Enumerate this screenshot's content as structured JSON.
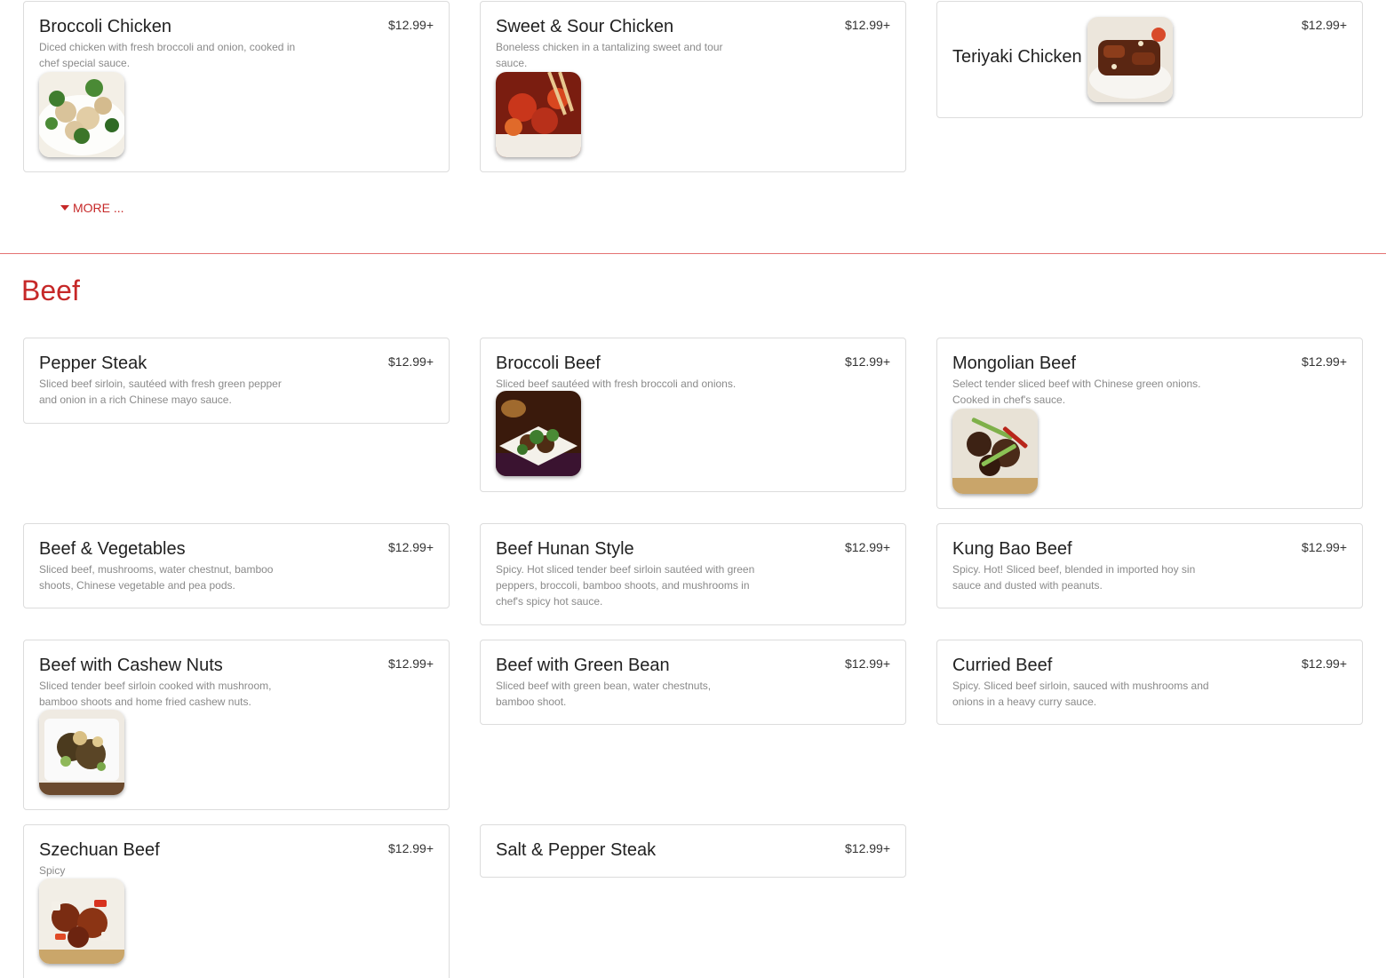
{
  "more_label": "MORE ...",
  "section_title": "Beef",
  "items": {
    "broccoli_chicken": {
      "name": "Broccoli Chicken",
      "price": "$12.99+",
      "desc": "Diced chicken with fresh broccoli and onion, cooked in chef special sauce."
    },
    "sweet_sour_chicken": {
      "name": "Sweet & Sour Chicken",
      "price": "$12.99+",
      "desc": "Boneless chicken in a tantalizing sweet and tour sauce."
    },
    "teriyaki_chicken": {
      "name": "Teriyaki Chicken",
      "price": "$12.99+"
    },
    "pepper_steak": {
      "name": "Pepper Steak",
      "price": "$12.99+",
      "desc": "Sliced beef sirloin, sautéed with fresh green pepper and onion in a rich Chinese mayo sauce."
    },
    "broccoli_beef": {
      "name": "Broccoli Beef",
      "price": "$12.99+",
      "desc": "Sliced beef sautéed with fresh broccoli and onions."
    },
    "mongolian_beef": {
      "name": "Mongolian Beef",
      "price": "$12.99+",
      "desc": "Select tender sliced beef with Chinese green onions. Cooked in chef's sauce."
    },
    "beef_vegetables": {
      "name": "Beef & Vegetables",
      "price": "$12.99+",
      "desc": "Sliced beef, mushrooms, water chestnut, bamboo shoots, Chinese vegetable and pea pods."
    },
    "beef_hunan": {
      "name": "Beef Hunan Style",
      "price": "$12.99+",
      "desc": "Spicy. Hot sliced tender beef sirloin sautéed with green peppers, broccoli, bamboo shoots, and mushrooms in chef's spicy hot sauce."
    },
    "kung_bao_beef": {
      "name": "Kung Bao Beef",
      "price": "$12.99+",
      "desc": "Spicy. Hot! Sliced beef, blended in imported hoy sin sauce and dusted with peanuts."
    },
    "beef_cashew": {
      "name": "Beef with Cashew Nuts",
      "price": "$12.99+",
      "desc": "Sliced tender beef sirloin cooked with mushroom, bamboo shoots and home fried cashew nuts."
    },
    "beef_green_bean": {
      "name": "Beef with Green Bean",
      "price": "$12.99+",
      "desc": "Sliced beef with green bean, water chestnuts, bamboo shoot."
    },
    "curried_beef": {
      "name": "Curried Beef",
      "price": "$12.99+",
      "desc": "Spicy. Sliced beef sirloin, sauced with mushrooms and onions in a heavy curry sauce."
    },
    "szechuan_beef": {
      "name": "Szechuan Beef",
      "price": "$12.99+",
      "desc": "Spicy"
    },
    "salt_pepper_steak": {
      "name": "Salt & Pepper Steak",
      "price": "$12.99+"
    }
  }
}
